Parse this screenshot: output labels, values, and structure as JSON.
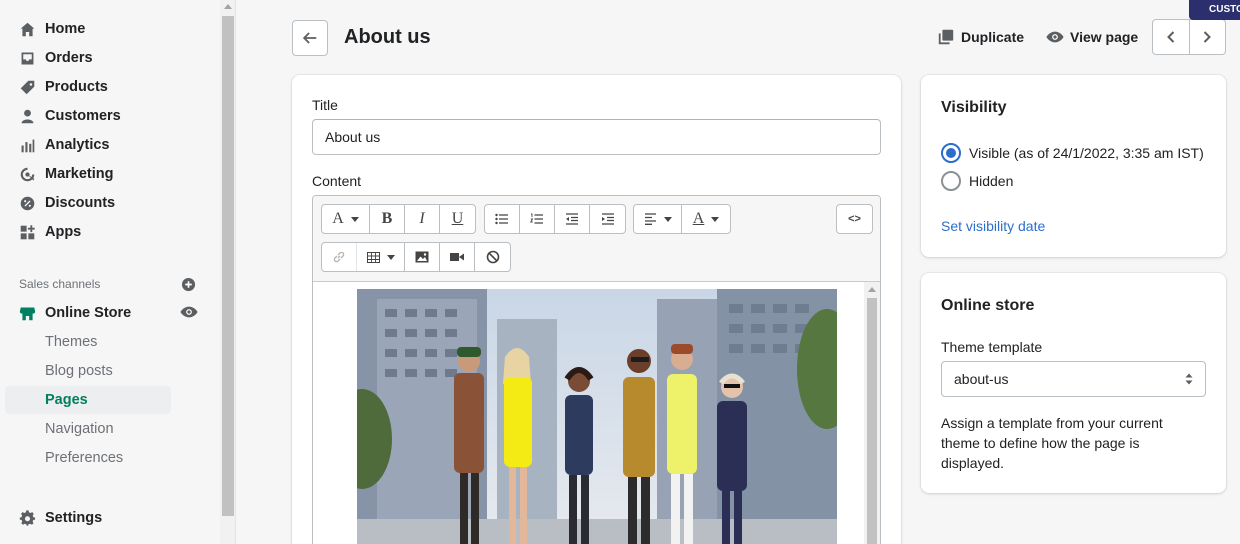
{
  "sidebar": {
    "items": [
      {
        "label": "Home",
        "icon": "home-icon"
      },
      {
        "label": "Orders",
        "icon": "orders-icon"
      },
      {
        "label": "Products",
        "icon": "tag-icon"
      },
      {
        "label": "Customers",
        "icon": "person-icon"
      },
      {
        "label": "Analytics",
        "icon": "bar-chart-icon"
      },
      {
        "label": "Marketing",
        "icon": "target-icon"
      },
      {
        "label": "Discounts",
        "icon": "discount-icon"
      },
      {
        "label": "Apps",
        "icon": "apps-icon"
      }
    ],
    "sales_channels_label": "Sales channels",
    "online_store": "Online Store",
    "sub_items": [
      "Themes",
      "Blog posts",
      "Pages",
      "Navigation",
      "Preferences"
    ],
    "active_sub": "Pages",
    "settings": "Settings"
  },
  "header": {
    "title": "About us",
    "duplicate": "Duplicate",
    "view_page": "View page",
    "badge": "CUSTO"
  },
  "form": {
    "title_label": "Title",
    "title_value": "About us",
    "content_label": "Content"
  },
  "visibility": {
    "title": "Visibility",
    "visible_label": "Visible (as of 24/1/2022, 3:35 am IST)",
    "hidden_label": "Hidden",
    "selected": "Visible",
    "set_date_link": "Set visibility date"
  },
  "online_store_card": {
    "title": "Online store",
    "template_label": "Theme template",
    "template_value": "about-us",
    "help": "Assign a template from your current theme to define how the page is displayed."
  },
  "colors": {
    "accent": "#008060",
    "link": "#2c6ecb",
    "badge": "#2c2f6e"
  }
}
